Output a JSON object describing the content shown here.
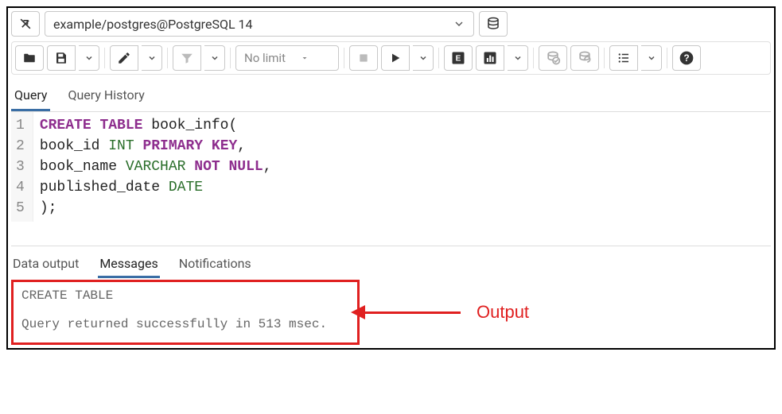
{
  "connection": {
    "label": "example/postgres@PostgreSQL 14"
  },
  "toolbar": {
    "limit_label": "No limit"
  },
  "editor_tabs": [
    {
      "label": "Query",
      "active": true
    },
    {
      "label": "Query History",
      "active": false
    }
  ],
  "code_lines": [
    {
      "n": "1",
      "tokens": [
        [
          "kw",
          "CREATE"
        ],
        [
          "",
          ""
        ],
        [
          "kw",
          "TABLE"
        ],
        [
          "",
          " "
        ],
        [
          "id",
          "book_info("
        ]
      ]
    },
    {
      "n": "2",
      "tokens": [
        [
          "id",
          "book_id "
        ],
        [
          "ty",
          "INT"
        ],
        [
          "",
          " "
        ],
        [
          "kw",
          "PRIMARY"
        ],
        [
          "",
          " "
        ],
        [
          "kw",
          "KEY"
        ],
        [
          "id",
          ","
        ]
      ]
    },
    {
      "n": "3",
      "tokens": [
        [
          "id",
          "book_name "
        ],
        [
          "ty",
          "VARCHAR"
        ],
        [
          "",
          " "
        ],
        [
          "kw",
          "NOT"
        ],
        [
          "",
          " "
        ],
        [
          "kw",
          "NULL"
        ],
        [
          "id",
          ","
        ]
      ]
    },
    {
      "n": "4",
      "tokens": [
        [
          "id",
          "published_date "
        ],
        [
          "ty",
          "DATE"
        ]
      ]
    },
    {
      "n": "5",
      "tokens": [
        [
          "id",
          ");"
        ]
      ]
    }
  ],
  "output_tabs": [
    {
      "label": "Data output",
      "active": false
    },
    {
      "label": "Messages",
      "active": true
    },
    {
      "label": "Notifications",
      "active": false
    }
  ],
  "messages": {
    "line1": "CREATE TABLE",
    "line2": "Query returned successfully in 513 msec."
  },
  "annotation": {
    "label": "Output"
  },
  "colors": {
    "accent": "#3a6ea5",
    "annotation": "#e02020",
    "keyword": "#8e2e8e",
    "type": "#2a6e2a"
  }
}
